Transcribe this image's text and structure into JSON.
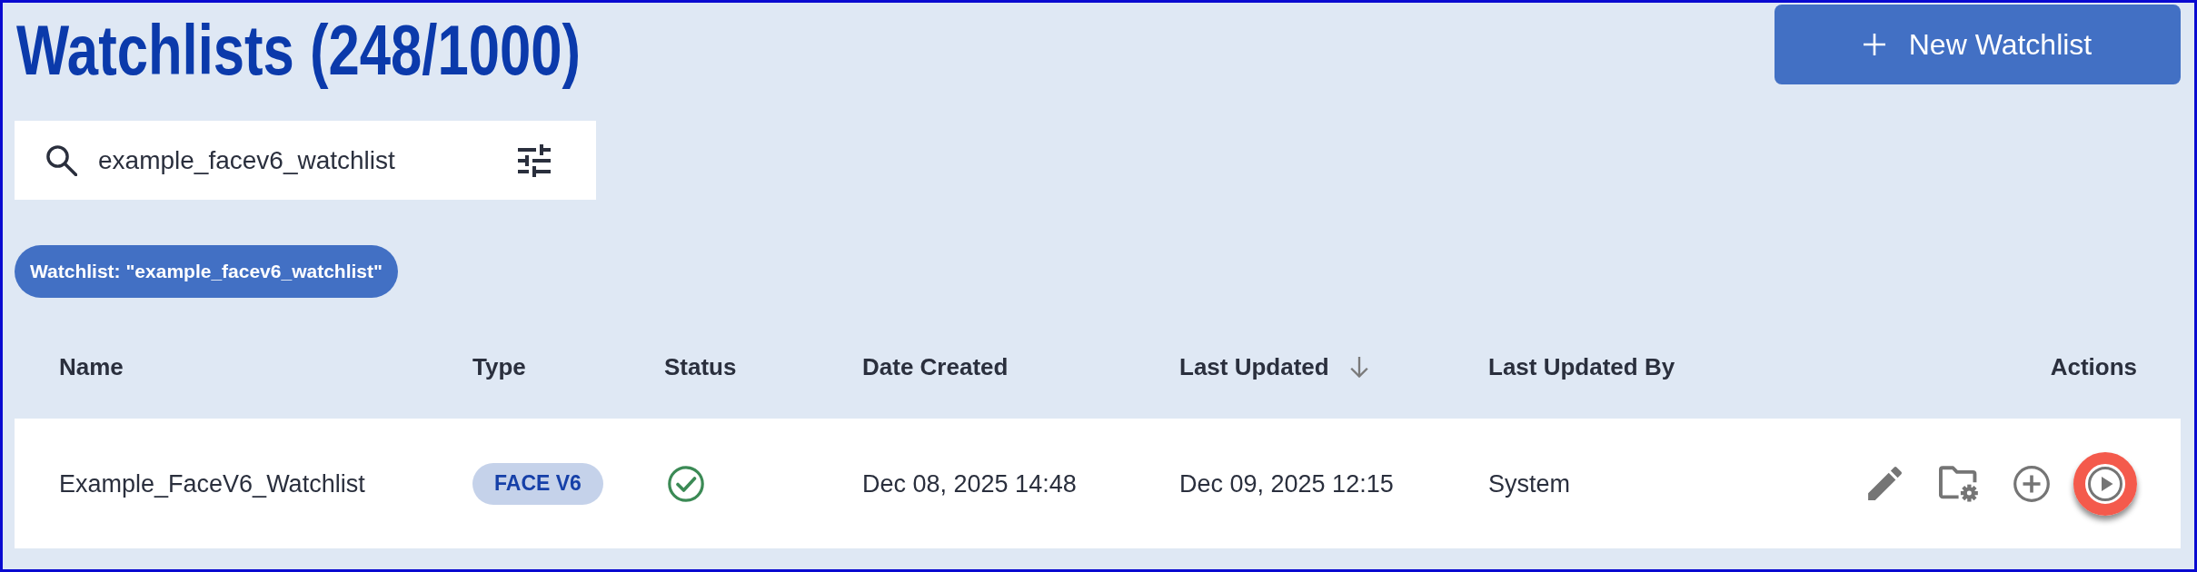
{
  "title": "Watchlists (248/1000)",
  "new_button": {
    "label": "New Watchlist"
  },
  "search": {
    "value": "example_facev6_watchlist"
  },
  "filter_chips": [
    {
      "label": "Watchlist: \"example_facev6_watchlist\""
    }
  ],
  "table": {
    "columns": [
      {
        "label": "Name",
        "sorted": false
      },
      {
        "label": "Type",
        "sorted": false
      },
      {
        "label": "Status",
        "sorted": false
      },
      {
        "label": "Date Created",
        "sorted": false
      },
      {
        "label": "Last Updated",
        "sorted": true
      },
      {
        "label": "Last Updated By",
        "sorted": false
      },
      {
        "label": "Actions",
        "sorted": false
      }
    ],
    "rows": [
      {
        "name": "Example_FaceV6_Watchlist",
        "type": "FACE V6",
        "status_ok": true,
        "date_created": "Dec 08, 2025 14:48",
        "last_updated": "Dec 09, 2025 12:15",
        "last_updated_by": "System",
        "actions": [
          {
            "kind": "edit",
            "highlighted": false
          },
          {
            "kind": "folder-settings",
            "highlighted": false
          },
          {
            "kind": "add",
            "highlighted": false
          },
          {
            "kind": "play",
            "highlighted": true
          }
        ]
      }
    ]
  }
}
